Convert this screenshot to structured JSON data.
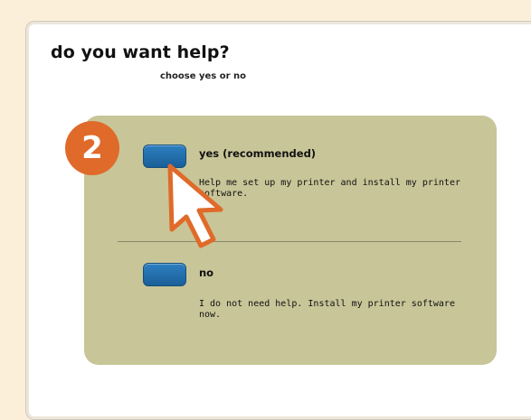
{
  "header": {
    "title": "do you want help?",
    "subtitle": "choose yes or no"
  },
  "step": {
    "number": "2",
    "color": "#e06a2a"
  },
  "options": [
    {
      "label": "yes (recommended)",
      "description": "Help me set up my printer and install my printer software."
    },
    {
      "label": "no",
      "description": "I do not need help. Install my printer software now."
    }
  ],
  "colors": {
    "background": "#fcefd9",
    "panel": "#c8c598",
    "button": "#1f6aa8"
  },
  "icons": {
    "cursor": "pointer-cursor-icon"
  }
}
